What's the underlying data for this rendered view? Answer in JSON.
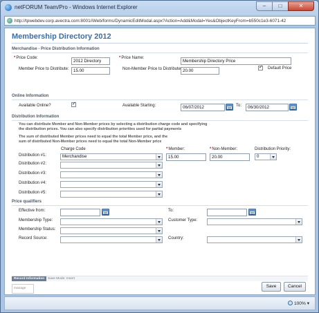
{
  "window": {
    "title": "netFORUM Team/Pro - Windows Internet Explorer",
    "minimize": "–",
    "maximize": "□",
    "close": "✕"
  },
  "address": {
    "url": "http://tpwebdev.corp.avectra.com:8001/iWeb/forms/DynamicEditModal.aspx?Action=Add&Modal=Yes&ObjectKeyFrom=b550c1e3-6071-42"
  },
  "page": {
    "title": "Membership Directory 2012"
  },
  "price_section": {
    "header": "Merchandise - Price Distribution Information",
    "price_code_label": "Price Code:",
    "price_code_value": "2012 Directory",
    "price_name_label": "Price Name:",
    "price_name_value": "Membership Directory Price",
    "member_price_label": "Member Price to Distribute:",
    "member_price_value": "15.00",
    "nonmember_price_label": "Non-Member Price to Distribute:",
    "nonmember_price_value": "20.00",
    "default_price_label": "Default Price",
    "default_price_checked": "✓"
  },
  "online_section": {
    "header": "Online Information",
    "available_online_label": "Available Online?",
    "available_online_checked": "✓",
    "available_starting_label": "Available Starting:",
    "available_starting_value": "06/07/2012",
    "to_label": "To:",
    "to_value": "06/30/2012"
  },
  "distribution_section": {
    "header": "Distribution Information",
    "note_line1": "You can distribute Member and Non-Member prices by selecting a distribution charge code and specifying",
    "note_line2": "the distribution prices. You can also specify distribution priorities used for partial payments",
    "note_line3": "The sum of distributed Member prices need to equal the total Member price, and the",
    "note_line4": "sum of distributed Non-Member prices need to equal the total Non-Member price",
    "col_charge_code": "Charge Code",
    "col_member": "Member:",
    "col_nonmember": "Non-Member:",
    "col_priority": "Distribution Priority:",
    "rows": [
      {
        "label": "Distribution #1:",
        "charge_code": "Merchandise",
        "member": "15.00",
        "nonmember": "20.00",
        "priority": "0"
      },
      {
        "label": "Distribution #2:",
        "charge_code": ""
      },
      {
        "label": "Distribution #3:",
        "charge_code": ""
      },
      {
        "label": "Distribution #4:",
        "charge_code": ""
      },
      {
        "label": "Distribution #5:",
        "charge_code": ""
      }
    ]
  },
  "qualifiers_section": {
    "header": "Price qualifiers",
    "effective_from_label": "Effective from:",
    "to_label": "To:",
    "membership_type_label": "Membership Type:",
    "customer_type_label": "Customer Type:",
    "membership_status_label": "Membership Status:",
    "record_source_label": "Record Source:",
    "country_label": "Country:"
  },
  "footer": {
    "record_information": "Record Information",
    "save_mode": "Save Mode: Insert",
    "manage_label": "manage",
    "save_label": "Save",
    "cancel_label": "Cancel"
  },
  "statusbar": {
    "zoom": "100%",
    "zoom_arrow": "▾"
  }
}
